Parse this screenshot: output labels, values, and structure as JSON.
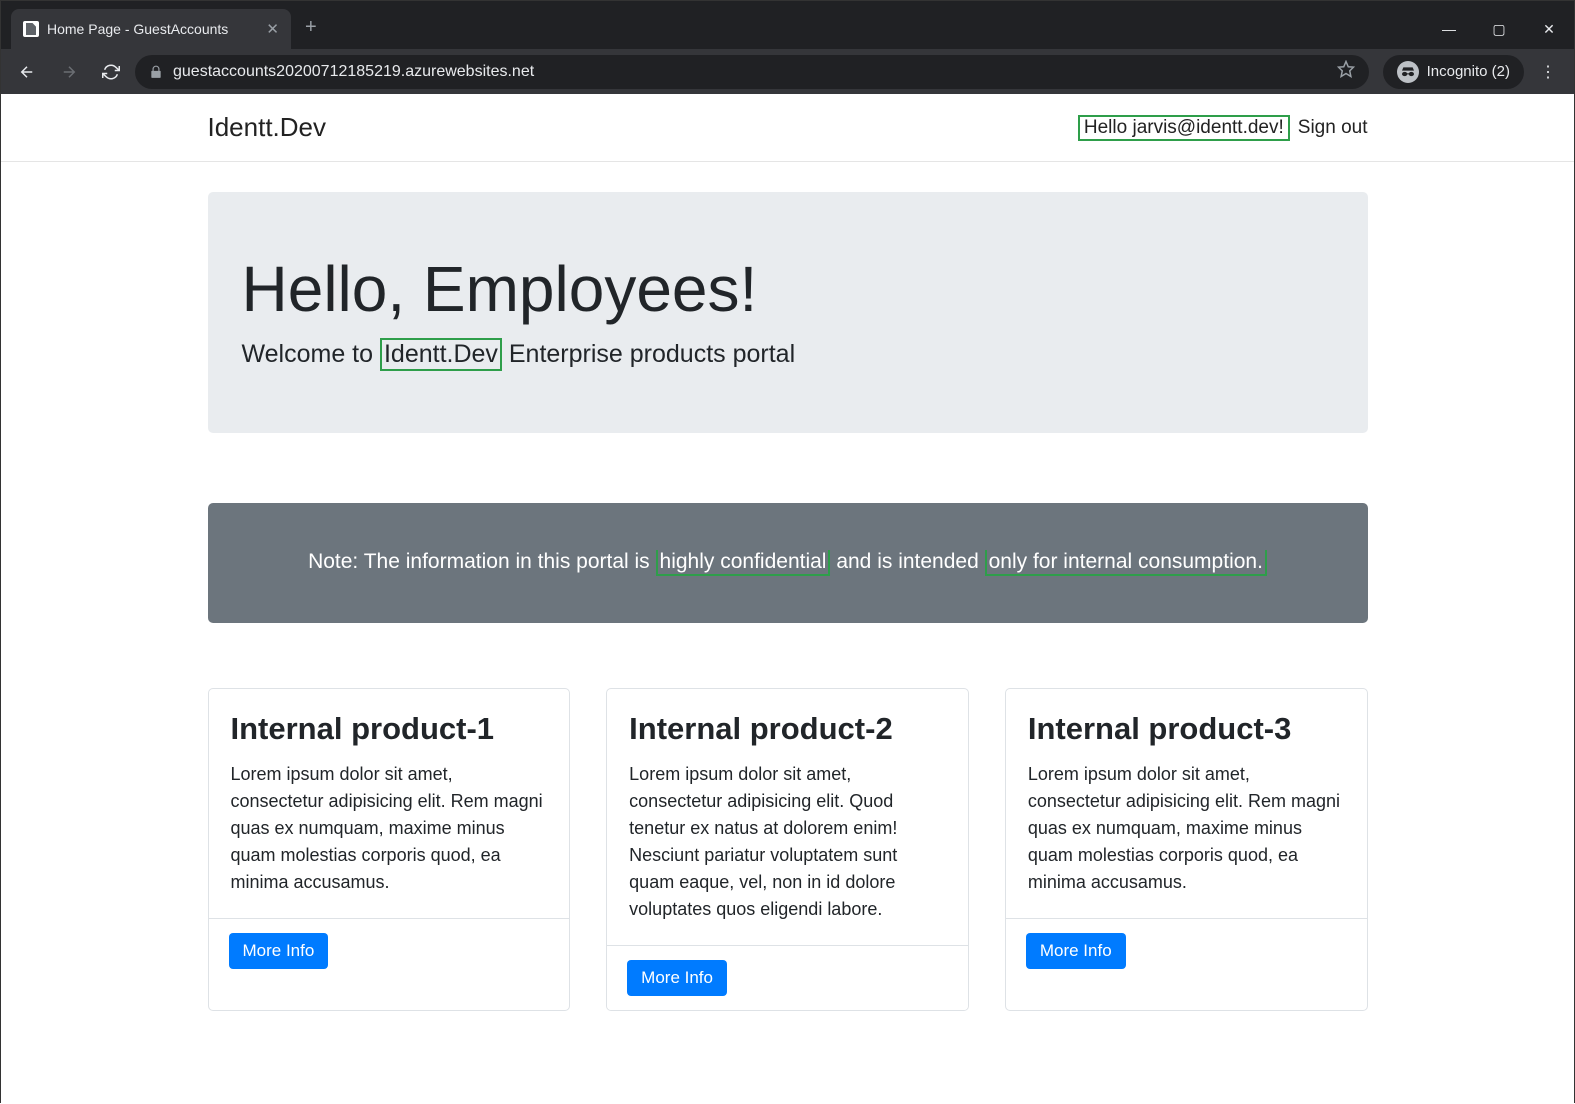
{
  "browser": {
    "tab_title": "Home Page - GuestAccounts",
    "url": "guestaccounts20200712185219.azurewebsites.net",
    "incognito_label": "Incognito (2)"
  },
  "navbar": {
    "brand": "Identt.Dev",
    "greeting": "Hello jarvis@identt.dev!",
    "signout": "Sign out"
  },
  "hero": {
    "title": "Hello, Employees!",
    "subtitle_pre": "Welcome to ",
    "subtitle_hl": "Identt.Dev",
    "subtitle_post": " Enterprise products portal"
  },
  "alert": {
    "prefix": "Note: The information in this portal is ",
    "hl1": "highly confidential",
    "mid": " and is intended ",
    "hl2": "only for internal consumption."
  },
  "cards": [
    {
      "title": "Internal product-1",
      "body": "Lorem ipsum dolor sit amet, consectetur adipisicing elit. Rem magni quas ex numquam, maxime minus quam molestias corporis quod, ea minima accusamus.",
      "button": "More Info"
    },
    {
      "title": "Internal product-2",
      "body": "Lorem ipsum dolor sit amet, consectetur adipisicing elit. Quod tenetur ex natus at dolorem enim! Nesciunt pariatur voluptatem sunt quam eaque, vel, non in id dolore voluptates quos eligendi labore.",
      "button": "More Info"
    },
    {
      "title": "Internal product-3",
      "body": "Lorem ipsum dolor sit amet, consectetur adipisicing elit. Rem magni quas ex numquam, maxime minus quam molestias corporis quod, ea minima accusamus.",
      "button": "More Info"
    }
  ]
}
